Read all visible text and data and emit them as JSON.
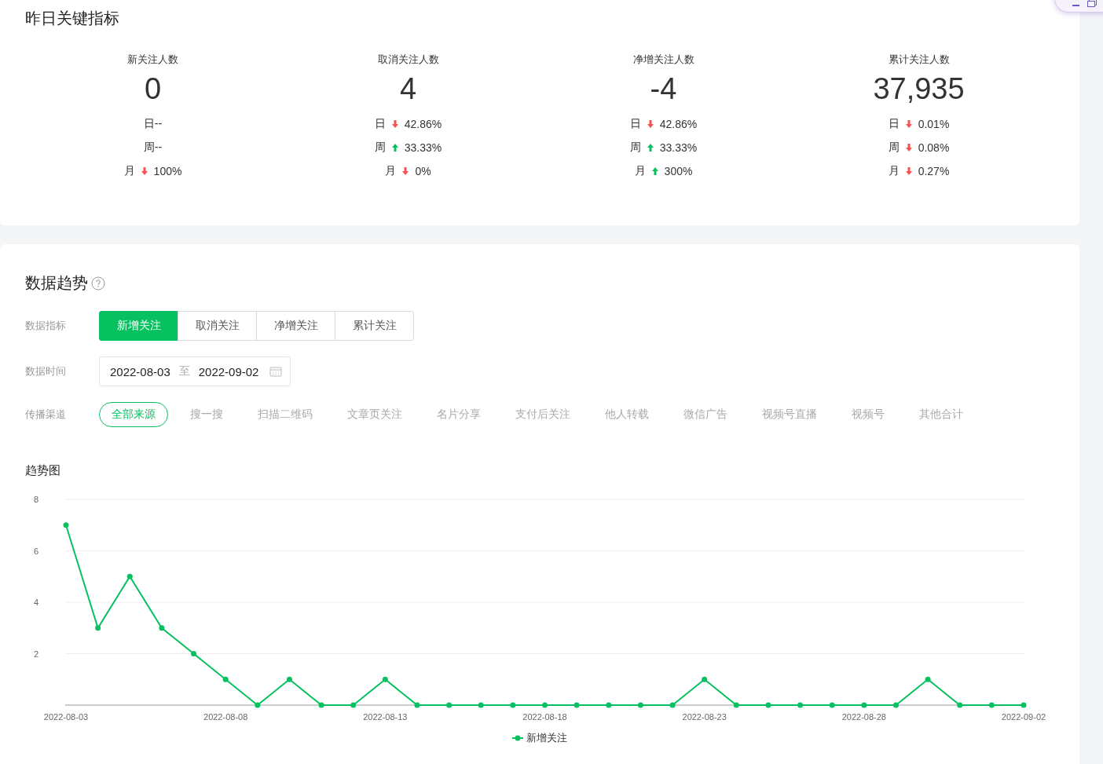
{
  "key_metrics": {
    "title": "昨日关键指标",
    "items": [
      {
        "label": "新关注人数",
        "value": "0",
        "rows": [
          {
            "kind": "plain",
            "text": "日--"
          },
          {
            "kind": "plain",
            "text": "周--"
          },
          {
            "kind": "fall",
            "label": "月",
            "value": "100%"
          }
        ]
      },
      {
        "label": "取消关注人数",
        "value": "4",
        "rows": [
          {
            "kind": "fall",
            "label": "日",
            "value": "42.86%"
          },
          {
            "kind": "rise",
            "label": "周",
            "value": "33.33%"
          },
          {
            "kind": "fall",
            "label": "月",
            "value": "0%"
          }
        ]
      },
      {
        "label": "净增关注人数",
        "value": "-4",
        "rows": [
          {
            "kind": "fall",
            "label": "日",
            "value": "42.86%"
          },
          {
            "kind": "rise",
            "label": "周",
            "value": "33.33%"
          },
          {
            "kind": "rise",
            "label": "月",
            "value": "300%"
          }
        ]
      },
      {
        "label": "累计关注人数",
        "value": "37,935",
        "rows": [
          {
            "kind": "fall",
            "label": "日",
            "value": "0.01%"
          },
          {
            "kind": "fall",
            "label": "周",
            "value": "0.08%"
          },
          {
            "kind": "fall",
            "label": "月",
            "value": "0.27%"
          }
        ]
      }
    ]
  },
  "trend": {
    "title": "数据趋势",
    "metric_label": "数据指标",
    "metric_tabs": [
      {
        "label": "新增关注",
        "selected": true
      },
      {
        "label": "取消关注",
        "selected": false
      },
      {
        "label": "净增关注",
        "selected": false
      },
      {
        "label": "累计关注",
        "selected": false
      }
    ],
    "time_label": "数据时间",
    "date_from": "2022-08-03",
    "date_sep": "至",
    "date_to": "2022-09-02",
    "channel_label": "传播渠道",
    "channels": [
      {
        "label": "全部来源",
        "selected": true
      },
      {
        "label": "搜一搜",
        "selected": false
      },
      {
        "label": "扫描二维码",
        "selected": false
      },
      {
        "label": "文章页关注",
        "selected": false
      },
      {
        "label": "名片分享",
        "selected": false
      },
      {
        "label": "支付后关注",
        "selected": false
      },
      {
        "label": "他人转载",
        "selected": false
      },
      {
        "label": "微信广告",
        "selected": false
      },
      {
        "label": "视频号直播",
        "selected": false
      },
      {
        "label": "视频号",
        "selected": false
      },
      {
        "label": "其他合计",
        "selected": false
      }
    ],
    "chart_title": "趋势图",
    "chart_data": {
      "type": "line",
      "x": [
        "2022-08-03",
        "2022-08-04",
        "2022-08-05",
        "2022-08-06",
        "2022-08-07",
        "2022-08-08",
        "2022-08-09",
        "2022-08-10",
        "2022-08-11",
        "2022-08-12",
        "2022-08-13",
        "2022-08-14",
        "2022-08-15",
        "2022-08-16",
        "2022-08-17",
        "2022-08-18",
        "2022-08-19",
        "2022-08-20",
        "2022-08-21",
        "2022-08-22",
        "2022-08-23",
        "2022-08-24",
        "2022-08-25",
        "2022-08-26",
        "2022-08-27",
        "2022-08-28",
        "2022-08-29",
        "2022-08-30",
        "2022-08-31",
        "2022-09-01",
        "2022-09-02"
      ],
      "series": [
        {
          "name": "新增关注",
          "color": "#07c160",
          "marker": "circle",
          "values": [
            7,
            3,
            5,
            3,
            2,
            1,
            0,
            1,
            0,
            0,
            1,
            0,
            0,
            0,
            0,
            0,
            0,
            0,
            0,
            0,
            1,
            0,
            0,
            0,
            0,
            0,
            0,
            1,
            0,
            0,
            0
          ]
        }
      ],
      "xlim": [
        "2022-08-03",
        "2022-09-02"
      ],
      "grid": true,
      "ylim": [
        0,
        8
      ],
      "yticks": [
        2,
        4,
        6,
        8
      ],
      "xticks": [
        "2022-08-03",
        "2022-08-08",
        "2022-08-13",
        "2022-08-18",
        "2022-08-23",
        "2022-08-28",
        "2022-09-02"
      ]
    }
  }
}
